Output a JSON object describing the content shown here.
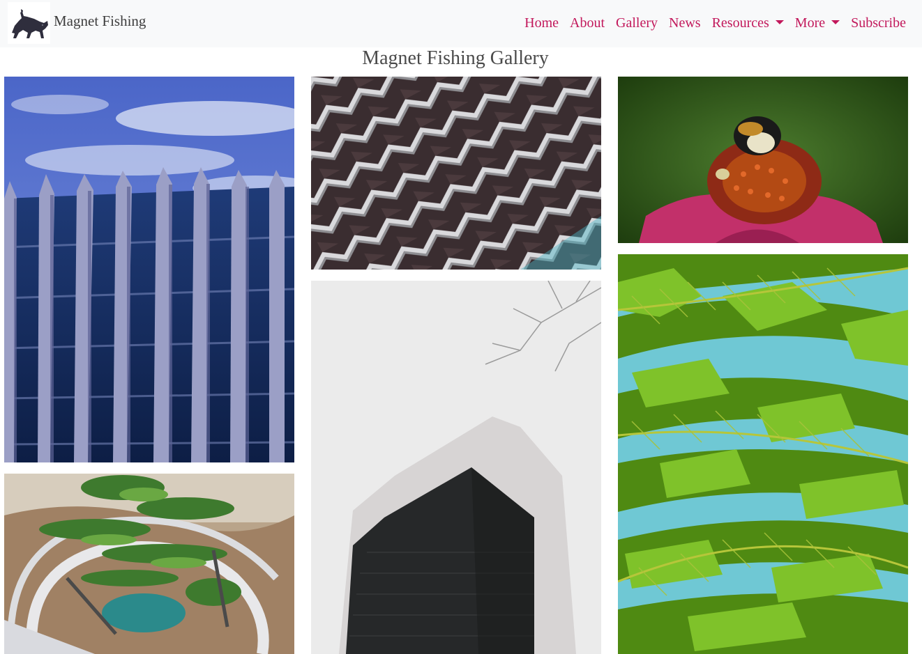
{
  "brand": {
    "name": "Magnet Fishing",
    "logo_icon": "dog-icon"
  },
  "nav": {
    "items": [
      {
        "label": "Home"
      },
      {
        "label": "About"
      },
      {
        "label": "Gallery"
      },
      {
        "label": "News"
      },
      {
        "label": "Resources",
        "dropdown": true
      },
      {
        "label": "More",
        "dropdown": true
      },
      {
        "label": "Subscribe"
      }
    ]
  },
  "page": {
    "title": "Magnet Fishing Gallery"
  },
  "gallery": {
    "images": [
      {
        "subject": "building-facade-blue-sky"
      },
      {
        "subject": "atrium-with-escalators-and-plants"
      },
      {
        "subject": "geometric-facade-pattern"
      },
      {
        "subject": "dark-skyscraper-with-branches"
      },
      {
        "subject": "bee-on-coneflower"
      },
      {
        "subject": "fern-leaves"
      }
    ]
  },
  "colors": {
    "link": "#c2185b",
    "navbar_bg": "#f8f9fa",
    "title": "#4a4a4a"
  }
}
